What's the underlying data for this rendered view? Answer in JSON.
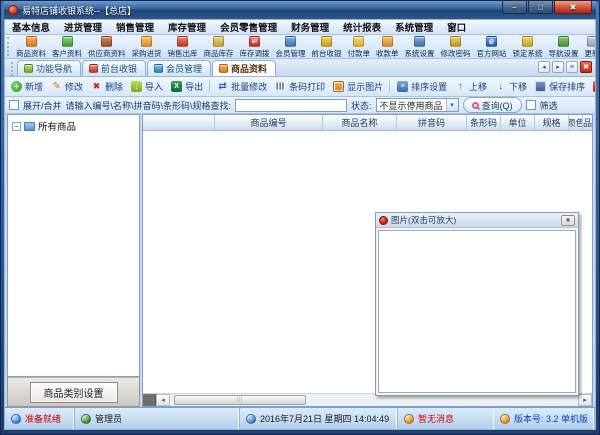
{
  "colors": {
    "status_red": "#d40000",
    "status_blue": "#1040c0",
    "accent_blue": "#2c5590"
  },
  "window": {
    "title": "易特店铺收银系统--【总店】",
    "minimize_glyph": "–",
    "maximize_glyph": "□",
    "close_glyph": "✖"
  },
  "menu_bar": {
    "items": [
      "基本信息",
      "进货管理",
      "销售管理",
      "库存管理",
      "会员零售管理",
      "财务管理",
      "统计报表",
      "系统管理",
      "窗口"
    ]
  },
  "toolbar": {
    "items": [
      {
        "label": "商品资料",
        "icon": "i-goods",
        "glyph": ""
      },
      {
        "label": "客户资料",
        "icon": "i-customer",
        "glyph": ""
      },
      {
        "label": "供应商资料",
        "icon": "i-supplier",
        "glyph": ""
      },
      {
        "label": "采购进货",
        "icon": "i-purchase",
        "glyph": ""
      },
      {
        "label": "销售出库",
        "icon": "i-sale",
        "glyph": ""
      },
      {
        "label": "商品库存",
        "icon": "i-stock",
        "glyph": ""
      },
      {
        "label": "库存调拨",
        "icon": "i-transfer",
        "glyph": "⇄"
      },
      {
        "label": "会员管理",
        "icon": "i-member",
        "glyph": ""
      },
      {
        "label": "前台收银",
        "icon": "i-cashier",
        "glyph": ""
      },
      {
        "label": "付款单",
        "icon": "i-payment",
        "glyph": ""
      },
      {
        "label": "收款单",
        "icon": "i-receipt",
        "glyph": ""
      },
      {
        "label": "系统设置",
        "icon": "i-settings",
        "glyph": ""
      },
      {
        "label": "修改密码",
        "icon": "i-password",
        "glyph": ""
      },
      {
        "label": "官方网站",
        "icon": "i-website",
        "glyph": "e"
      },
      {
        "label": "锁定系统",
        "icon": "i-lock",
        "glyph": ""
      },
      {
        "label": "导航设置",
        "icon": "i-nav",
        "glyph": ""
      },
      {
        "label": "更新",
        "icon": "i-update",
        "glyph": ""
      }
    ]
  },
  "tab_bar": {
    "tabs": [
      {
        "label": "功能导航",
        "icon": "t-nav",
        "state": ""
      },
      {
        "label": "前台收银",
        "icon": "t-cashier",
        "state": ""
      },
      {
        "label": "会员管理",
        "icon": "t-member",
        "state": ""
      },
      {
        "label": "商品资料",
        "icon": "t-goods",
        "state": "active"
      }
    ],
    "scroll_left_glyph": "◂",
    "scroll_right_glyph": "▸",
    "list_glyph": "≡",
    "close_glyph": "✖"
  },
  "action_bar": {
    "items": [
      {
        "label": "新增",
        "icon": "a-add",
        "glyph": "+",
        "sep": ""
      },
      {
        "label": "修改",
        "icon": "a-edit",
        "glyph": "✎",
        "sep": ""
      },
      {
        "label": "删除",
        "icon": "a-delete",
        "glyph": "✖",
        "sep": ""
      },
      {
        "label": "导入",
        "icon": "a-import",
        "glyph": "↓",
        "sep": ""
      },
      {
        "label": "导出",
        "icon": "a-export",
        "glyph": "X",
        "sep": ""
      },
      {
        "label": "批量修改",
        "icon": "a-batch",
        "glyph": "⇄",
        "sep": "sep"
      },
      {
        "label": "条码打印",
        "icon": "a-barcode",
        "glyph": "|||",
        "sep": ""
      },
      {
        "label": "显示图片",
        "icon": "a-image",
        "glyph": "",
        "sep": ""
      },
      {
        "label": "排序设置",
        "icon": "a-sort",
        "glyph": "≡",
        "sep": "sep"
      },
      {
        "label": "上移",
        "icon": "a-up",
        "glyph": "↑",
        "sep": ""
      },
      {
        "label": "下移",
        "icon": "a-down",
        "glyph": "↓",
        "sep": ""
      },
      {
        "label": "保存排序",
        "icon": "a-save",
        "glyph": "",
        "sep": ""
      },
      {
        "label": "关闭",
        "icon": "a-close",
        "glyph": "✖",
        "sep": ""
      }
    ]
  },
  "filter_bar": {
    "expand_label": "展开/合并",
    "search_label": "请输入编号\\名称\\拼音码\\条形码\\规格查找:",
    "search_value": "",
    "status_label": "状态:",
    "status_value": "不显示停用商品",
    "dropdown_glyph": "▾",
    "query_label": "查询(Q)",
    "filter_label": "筛选"
  },
  "tree_panel": {
    "expander_glyph": "−",
    "root_label": "所有商品",
    "category_button_label": "商品类别设置"
  },
  "table": {
    "columns": [
      "",
      "商品编号",
      "商品名称",
      "拼音码",
      "条形码",
      "单位",
      "规格",
      "颜色",
      "品牌"
    ],
    "rows": []
  },
  "image_panel": {
    "title": "图片(双击可放大)",
    "close_glyph": "✖"
  },
  "scrollbar": {
    "left_glyph": "◂",
    "right_glyph": "▸",
    "grip_glyph": "|||"
  },
  "status_bar": {
    "segments": [
      {
        "text": "准备就绪",
        "icon": "s-ready",
        "tone": "red"
      },
      {
        "text": "管理员",
        "icon": "s-user",
        "tone": ""
      },
      {
        "text": "2016年7月21日 星期四 14:04:49",
        "icon": "s-clock",
        "tone": ""
      },
      {
        "text": "暂无消息",
        "icon": "s-message",
        "tone": "red"
      },
      {
        "text": "版本号: 3.2 单机版",
        "icon": "s-version",
        "tone": "blue"
      }
    ]
  }
}
